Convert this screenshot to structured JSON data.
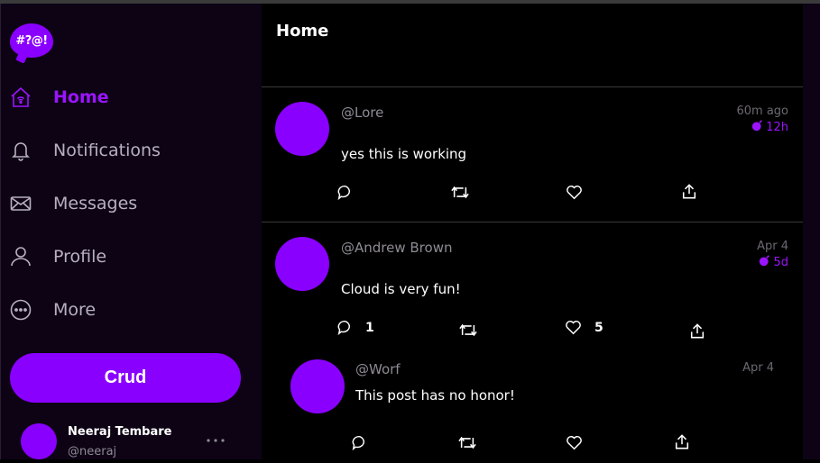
{
  "logo": {
    "text": "#?@!"
  },
  "nav": [
    {
      "label": "Home",
      "icon": "home-icon",
      "active": true
    },
    {
      "label": "Notifications",
      "icon": "bell-icon",
      "active": false
    },
    {
      "label": "Messages",
      "icon": "envelope-icon",
      "active": false
    },
    {
      "label": "Profile",
      "icon": "user-icon",
      "active": false
    },
    {
      "label": "More",
      "icon": "more-circle-icon",
      "active": false
    }
  ],
  "crud_button": {
    "label": "Crud"
  },
  "user": {
    "name": "Neeraj Tembare",
    "handle": "@neeraj"
  },
  "main": {
    "title": "Home"
  },
  "posts": [
    {
      "handle": "@Lore",
      "text": "yes this is working",
      "time": "60m ago",
      "ttl": "12h",
      "replies": "",
      "likes": ""
    },
    {
      "handle": "@Andrew Brown",
      "text": "Cloud is very fun!",
      "time": "Apr 4",
      "ttl": "5d",
      "replies": "1",
      "likes": "5"
    },
    {
      "handle": "@Worf",
      "text": "This post has no honor!",
      "time": "Apr 4",
      "ttl": "",
      "replies": "",
      "likes": ""
    }
  ],
  "colors": {
    "accent": "#8a00ff",
    "sidebar_bg": "#0d0315",
    "main_bg": "#000000",
    "muted_text": "#8f8a95"
  }
}
